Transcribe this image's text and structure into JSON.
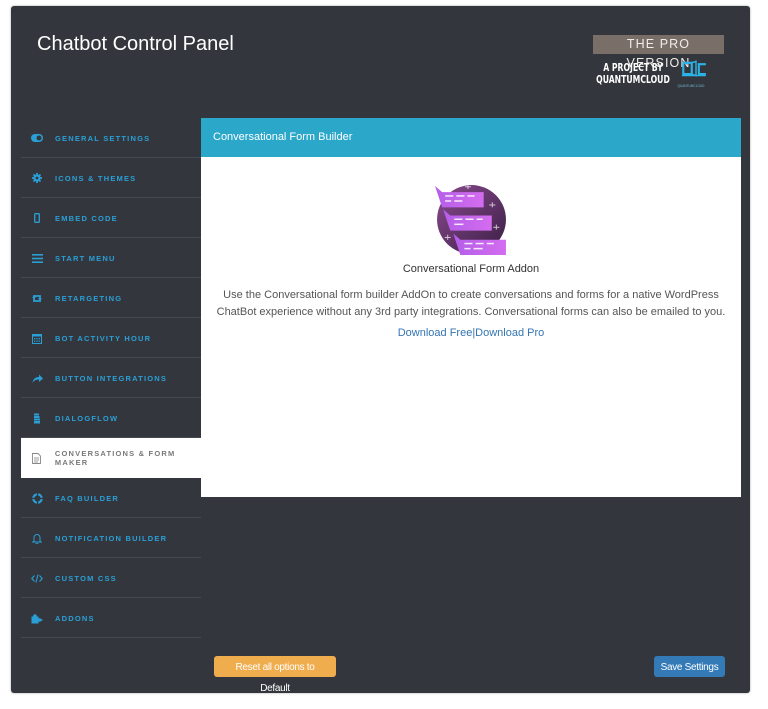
{
  "header": {
    "title": "Chatbot Control Panel",
    "pro_badge": "THE PRO VERSION",
    "project_by_line1": "A PROJECT BY",
    "project_by_line2": "QUANTUMCLOUD",
    "logo_caption": "QUANTUMCLOUD"
  },
  "sidebar": {
    "items": [
      {
        "label": "General Settings",
        "icon": "toggle-icon",
        "active": false
      },
      {
        "label": "Icons & Themes",
        "icon": "gear-icon",
        "active": false
      },
      {
        "label": "Embed Code",
        "icon": "mobile-icon",
        "active": false
      },
      {
        "label": "Start Menu",
        "icon": "menu-icon",
        "active": false
      },
      {
        "label": "Retargeting",
        "icon": "retweet-icon",
        "active": false
      },
      {
        "label": "Bot Activity Hour",
        "icon": "calendar-icon",
        "active": false
      },
      {
        "label": "Button Integrations",
        "icon": "share-icon",
        "active": false
      },
      {
        "label": "DialogFlow",
        "icon": "hand-icon",
        "active": false
      },
      {
        "label": "Conversations & Form Maker",
        "icon": "document-icon",
        "active": true
      },
      {
        "label": "FAQ Builder",
        "icon": "lifebuoy-icon",
        "active": false
      },
      {
        "label": "Notification Builder",
        "icon": "bell-icon",
        "active": false
      },
      {
        "label": "Custom CSS",
        "icon": "code-icon",
        "active": false
      },
      {
        "label": "Addons",
        "icon": "puzzle-icon",
        "active": false
      }
    ]
  },
  "content": {
    "header": "Conversational Form Builder",
    "addon_name": "Conversational Form Addon",
    "description": "Use the Conversational form builder AddOn to create conversations and forms for a native WordPress ChatBot experience without any 3rd party integrations. Conversational forms can also be emailed to you.",
    "link_free": "Download Free",
    "link_separator": "|",
    "link_pro": "Download Pro"
  },
  "footer": {
    "reset_label": "Reset all options to Default",
    "save_label": "Save Settings"
  },
  "colors": {
    "panel_bg": "#33373d",
    "accent": "#2ba7ca",
    "nav_text": "#2a9fd6",
    "reset_button": "#f0ad4e",
    "save_button": "#337ab7",
    "pro_badge_bg": "#7a6e69"
  }
}
